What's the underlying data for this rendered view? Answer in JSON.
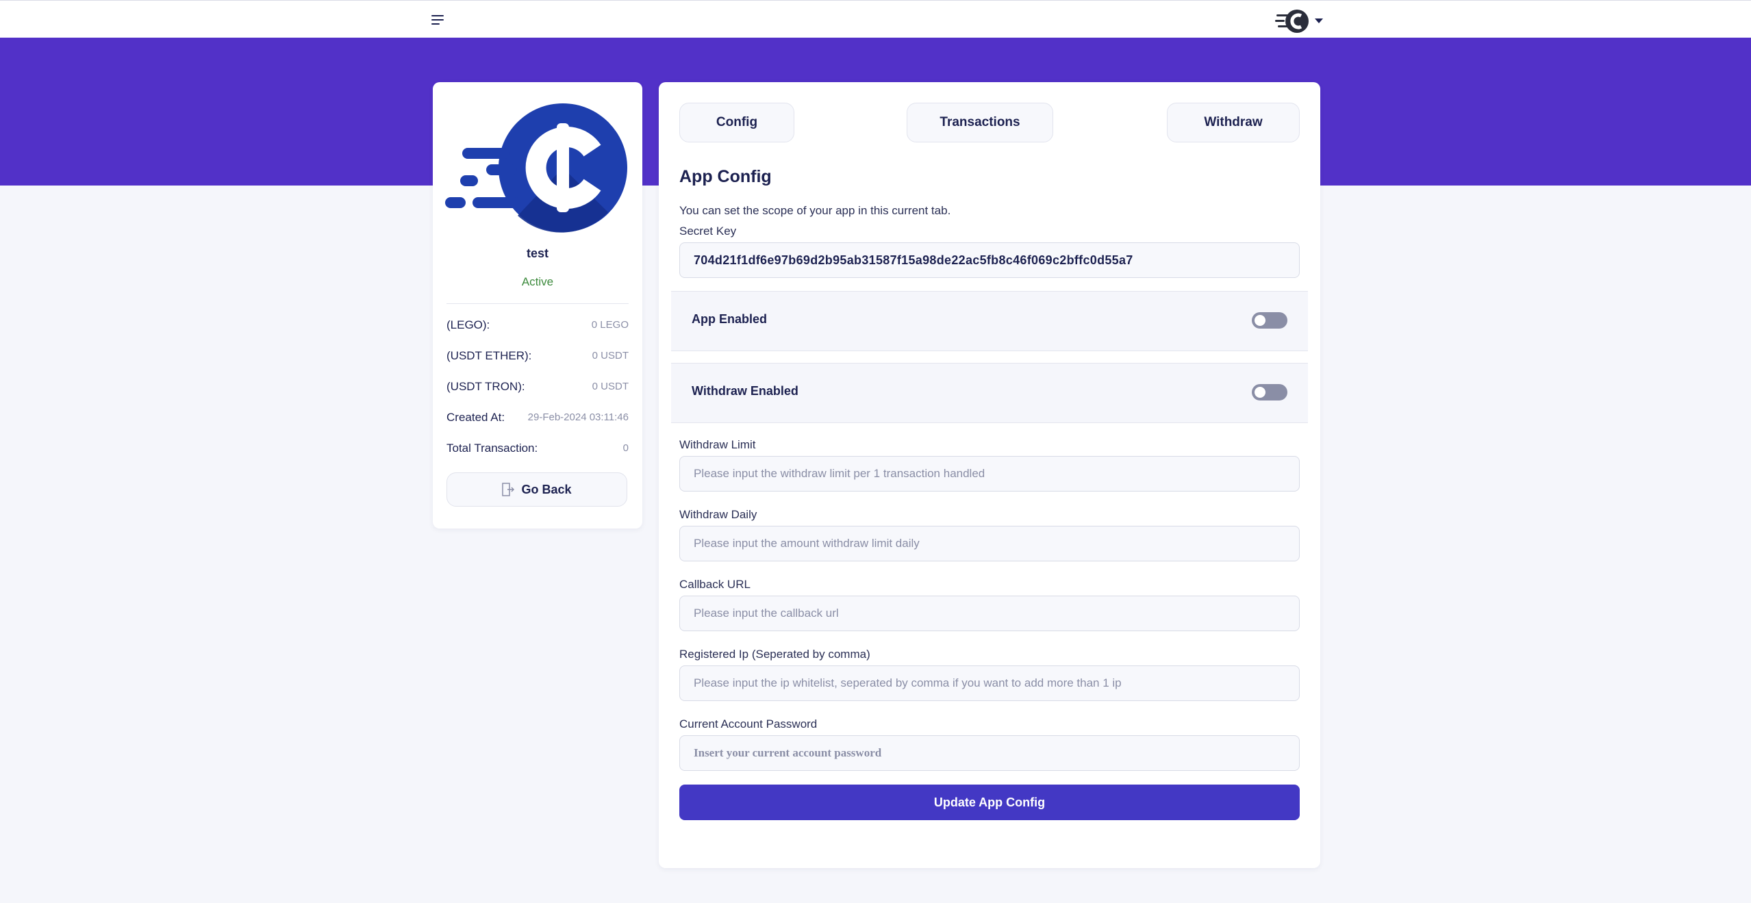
{
  "header": {
    "menu_icon": "hamburger-icon",
    "avatar_icon": "app-logo-icon",
    "dropdown_icon": "caret-down-icon"
  },
  "colors": {
    "banner": "#5231c8",
    "primary_button": "#4338c4",
    "status_active": "#3c8a3c",
    "logo_blue": "#1e3fae"
  },
  "app_card": {
    "name": "test",
    "status": "Active",
    "rows": [
      {
        "label": "(LEGO):",
        "value": "0 LEGO"
      },
      {
        "label": "(USDT ETHER):",
        "value": "0 USDT"
      },
      {
        "label": "(USDT TRON):",
        "value": "0 USDT"
      },
      {
        "label": "Created At:",
        "value": "29-Feb-2024 03:11:46"
      },
      {
        "label": "Total Transaction:",
        "value": "0"
      }
    ],
    "go_back_label": "Go Back",
    "go_back_icon": "exit-door-icon"
  },
  "tabs": {
    "config": "Config",
    "transactions": "Transactions",
    "withdraw": "Withdraw"
  },
  "config": {
    "title": "App Config",
    "description": "You can set the scope of your app in this current tab.",
    "secret_key_label": "Secret Key",
    "secret_key_value": "704d21f1df6e97b69d2b95ab31587f15a98de22ac5fb8c46f069c2bffc0d55a7",
    "app_enabled_label": "App Enabled",
    "app_enabled": false,
    "withdraw_enabled_label": "Withdraw Enabled",
    "withdraw_enabled": false,
    "withdraw_limit_label": "Withdraw Limit",
    "withdraw_limit_placeholder": "Please input the withdraw limit per 1 transaction handled",
    "withdraw_daily_label": "Withdraw Daily",
    "withdraw_daily_placeholder": "Please input the amount withdraw limit daily",
    "callback_label": "Callback URL",
    "callback_placeholder": "Please input the callback url",
    "ip_label": "Registered Ip (Seperated by comma)",
    "ip_placeholder": "Please input the ip whitelist, seperated by comma if you want to add more than 1 ip",
    "password_label": "Current Account Password",
    "password_placeholder": "Insert your current account password",
    "submit_label": "Update App Config"
  }
}
